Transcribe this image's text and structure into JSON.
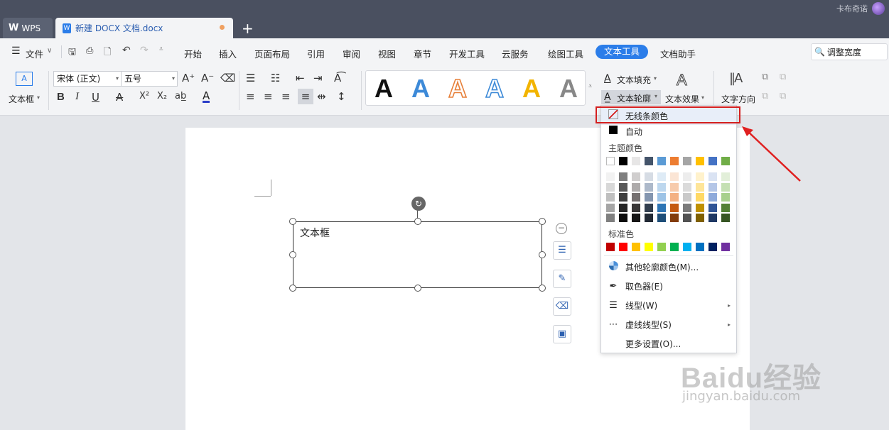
{
  "titlebar": {
    "tabs": [
      {
        "label": "WPS"
      },
      {
        "label": "新建 DOCX 文档.docx"
      }
    ],
    "new_tab": "+",
    "user_name": "卡布奇诺"
  },
  "menu": {
    "file_label": "文件",
    "items": [
      "开始",
      "插入",
      "页面布局",
      "引用",
      "审阅",
      "视图",
      "章节",
      "开发工具",
      "云服务",
      "绘图工具",
      "文本工具",
      "文档助手"
    ],
    "active": "文本工具",
    "search_label": "调整宽度"
  },
  "ribbon": {
    "textbox_label": "文本框",
    "font_name": "宋体 (正文)",
    "font_size": "五号",
    "text_fill": "文本填充",
    "text_outline": "文本轮廓",
    "text_effect": "文本效果",
    "text_direction": "文字方向",
    "style_colors": [
      "#111111",
      "#3d8ad8",
      "#e7803a",
      "#3d8ad8",
      "#f2b400",
      "#888888"
    ]
  },
  "document": {
    "textbox_text": "文本框"
  },
  "dropdown": {
    "no_line": "无线条颜色",
    "auto": "自动",
    "theme_colors_title": "主题颜色",
    "theme_top_row": [
      "#ffffff",
      "#000000",
      "#e7e6e6",
      "#44546a",
      "#5b9bd5",
      "#ed7d31",
      "#a5a5a5",
      "#ffc000",
      "#4472c4",
      "#70ad47"
    ],
    "theme_shades": [
      [
        "#f2f2f2",
        "#7f7f7f",
        "#d0cece",
        "#d6dce4",
        "#deebf6",
        "#fbe5d5",
        "#ededed",
        "#fff2cc",
        "#dae3f3",
        "#e2efd9"
      ],
      [
        "#d8d8d8",
        "#595959",
        "#aeabab",
        "#adb9ca",
        "#bdd7ee",
        "#f7cbac",
        "#dbdbdb",
        "#fee599",
        "#b4c6e7",
        "#c5e0b3"
      ],
      [
        "#bfbfbf",
        "#3f3f3f",
        "#757070",
        "#8496b0",
        "#9dc3e6",
        "#f4b183",
        "#c9c9c9",
        "#ffd965",
        "#8eaadb",
        "#a8d08d"
      ],
      [
        "#a5a5a5",
        "#262626",
        "#3a3838",
        "#323f4f",
        "#2e75b5",
        "#c55a11",
        "#7b7b7b",
        "#bf9000",
        "#2f5496",
        "#538135"
      ],
      [
        "#7f7f7f",
        "#0c0c0c",
        "#171616",
        "#222a35",
        "#1e4e79",
        "#833c0b",
        "#525252",
        "#7f6000",
        "#1f3864",
        "#375623"
      ]
    ],
    "standard_title": "标准色",
    "standard_colors": [
      "#c00000",
      "#ff0000",
      "#ffc000",
      "#ffff00",
      "#92d050",
      "#00b050",
      "#00b0f0",
      "#0070c0",
      "#002060",
      "#7030a0"
    ],
    "more_colors": "其他轮廓颜色(M)...",
    "eyedropper": "取色器(E)",
    "line_type": "线型(W)",
    "dash_type": "虚线线型(S)",
    "more_settings": "更多设置(O)..."
  },
  "watermark": {
    "logo": "Baidu经验",
    "url": "jingyan.baidu.com"
  }
}
